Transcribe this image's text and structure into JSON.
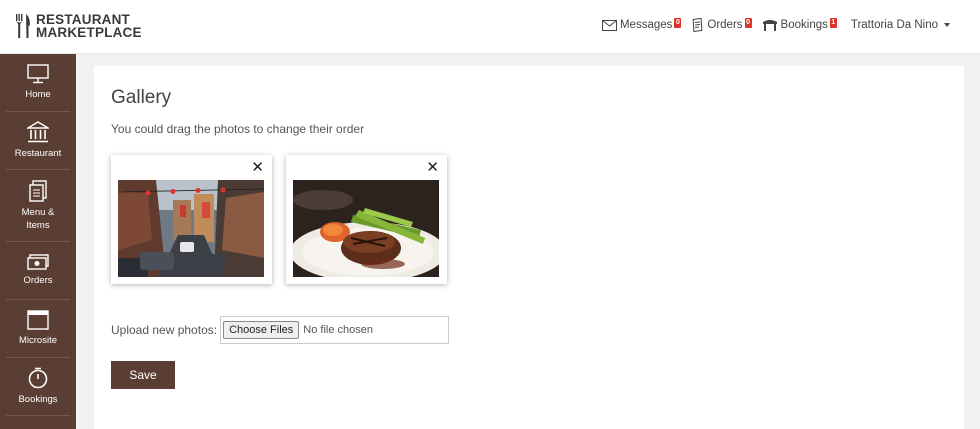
{
  "brand": {
    "line1": "RESTAURANT",
    "line2": "MARKETPLACE"
  },
  "nav": {
    "messages": {
      "label": "Messages",
      "count": "0"
    },
    "orders": {
      "label": "Orders",
      "count": "0"
    },
    "bookings": {
      "label": "Bookings",
      "count": "1"
    },
    "user": "Trattoria Da Nino"
  },
  "sidebar": {
    "items": [
      {
        "label": "Home",
        "icon": "monitor-icon"
      },
      {
        "label": "Restaurant",
        "icon": "building-icon"
      },
      {
        "label": "Menu &",
        "label2": "Items",
        "icon": "menu-icon"
      },
      {
        "label": "Orders",
        "icon": "cash-icon"
      },
      {
        "label": "Microsite",
        "icon": "window-icon"
      },
      {
        "label": "Bookings",
        "icon": "clock-icon"
      }
    ]
  },
  "gallery": {
    "title": "Gallery",
    "hint": "You could drag the photos to change their order",
    "photos": [
      {
        "alt": "Street scene",
        "close": "✕"
      },
      {
        "alt": "Steak dish",
        "close": "✕"
      }
    ]
  },
  "upload": {
    "label": "Upload new photos:",
    "button": "Choose Files",
    "status": "No file chosen"
  },
  "save_label": "Save",
  "colors": {
    "brand_brown": "#5a3e33",
    "badge_red": "#d9362b"
  }
}
